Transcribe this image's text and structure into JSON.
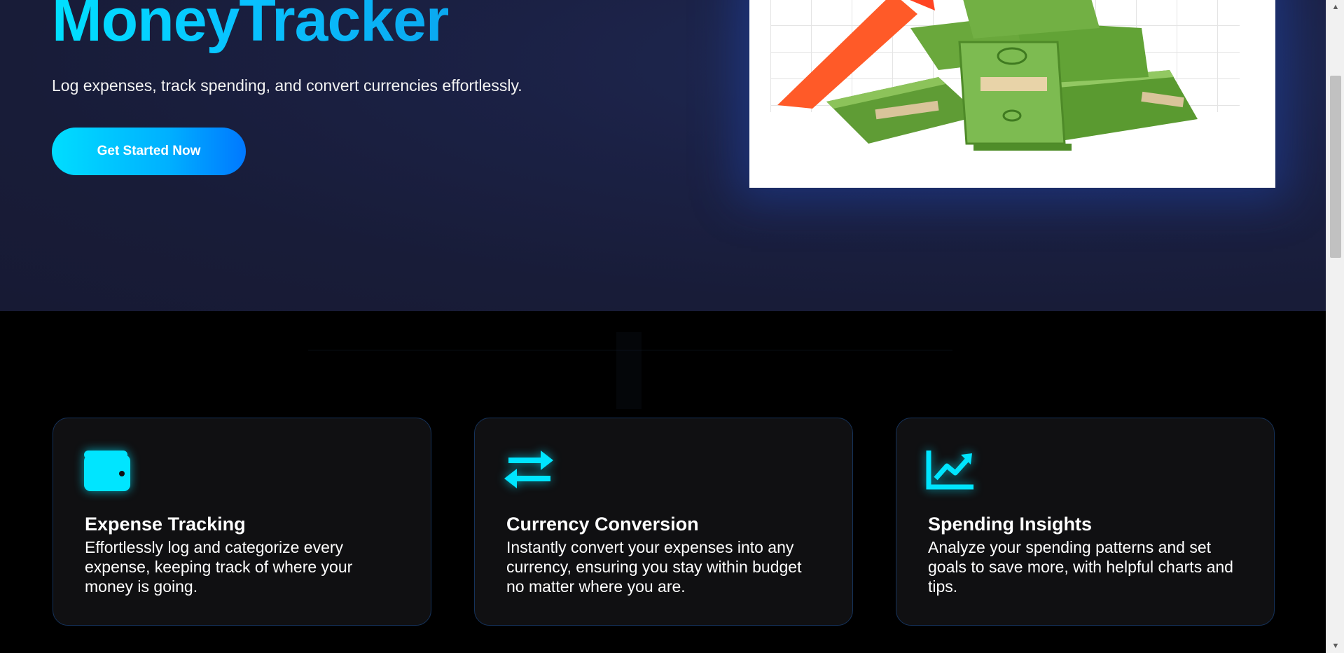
{
  "hero": {
    "title": "MoneyTracker",
    "subtitle": "Log expenses, track spending, and convert currencies effortlessly.",
    "cta_label": "Get Started Now"
  },
  "features": [
    {
      "icon": "wallet-icon",
      "title": "Expense Tracking",
      "text": "Effortlessly log and categorize every expense, keeping track of where your money is going."
    },
    {
      "icon": "exchange-arrows-icon",
      "title": "Currency Conversion",
      "text": "Instantly convert your expenses into any currency, ensuring you stay within budget no matter where you are."
    },
    {
      "icon": "line-chart-icon",
      "title": "Spending Insights",
      "text": "Analyze your spending patterns and set goals to save more, with helpful charts and tips."
    }
  ],
  "colors": {
    "accent_cyan": "#00e5ff",
    "accent_blue": "#0078ff",
    "hero_bg": "#181c38",
    "card_bg": "#101012",
    "card_border": "#15325a"
  }
}
